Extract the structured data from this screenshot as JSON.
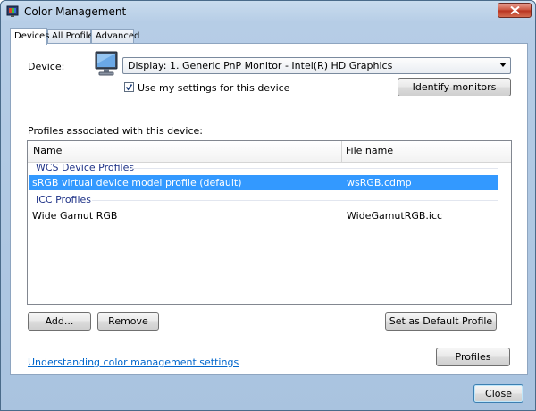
{
  "window": {
    "title": "Color Management"
  },
  "tabs": [
    "Devices",
    "All Profiles",
    "Advanced"
  ],
  "device": {
    "label": "Device:",
    "selected": "Display: 1. Generic PnP Monitor - Intel(R) HD Graphics",
    "use_my_settings_label": "Use my settings for this device",
    "use_my_settings_checked": true,
    "identify_button": "Identify monitors"
  },
  "profiles": {
    "section_label": "Profiles associated with this device:",
    "columns": [
      "Name",
      "File name"
    ],
    "groups": [
      {
        "name": "WCS Device Profiles",
        "rows": [
          {
            "name": "sRGB virtual device model profile (default)",
            "file": "wsRGB.cdmp",
            "selected": true
          }
        ]
      },
      {
        "name": "ICC Profiles",
        "rows": [
          {
            "name": "Wide Gamut RGB",
            "file": "WideGamutRGB.icc",
            "selected": false
          }
        ]
      }
    ]
  },
  "buttons": {
    "add": "Add...",
    "remove": "Remove",
    "set_default": "Set as Default Profile",
    "profiles": "Profiles",
    "close": "Close"
  },
  "link": "Understanding color management settings",
  "colors": {
    "selection": "#3399ff",
    "group_header": "#1e3287",
    "link": "#0066cc"
  }
}
